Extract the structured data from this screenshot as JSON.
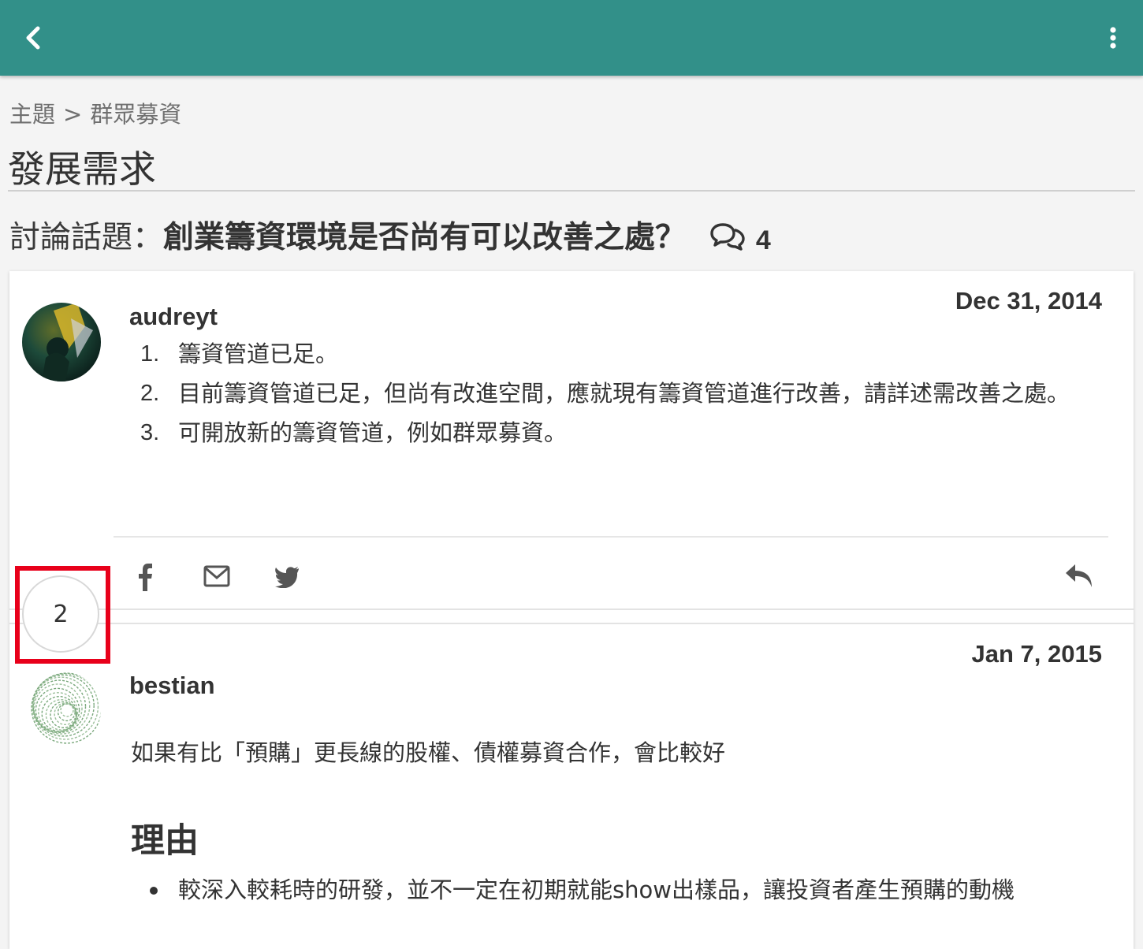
{
  "appbar": {
    "back_icon": "chevron-left-icon",
    "more_icon": "more-vertical-icon",
    "color": "#329089"
  },
  "breadcrumb": {
    "root": "主題",
    "separator": ">",
    "current": "群眾募資"
  },
  "page": {
    "title": "發展需求"
  },
  "topic": {
    "prefix": "討論話題：",
    "name": "創業籌資環境是否尚有可以改善之處？",
    "comment_count": "4"
  },
  "posts": [
    {
      "user": "audreyt",
      "date": "Dec 31, 2014",
      "items": [
        {
          "num": "1.",
          "text": "籌資管道已足。"
        },
        {
          "num": "2.",
          "text": "目前籌資管道已足，但尚有改進空間，應就現有籌資管道進行改善，請詳述需改善之處。"
        },
        {
          "num": "3.",
          "text": "可開放新的籌資管道，例如群眾募資。"
        }
      ],
      "actions": {
        "facebook_icon": "facebook-icon",
        "email_icon": "mail-icon",
        "twitter_icon": "twitter-icon",
        "reply_icon": "reply-icon"
      }
    },
    {
      "number": "2",
      "user": "bestian",
      "date": "Jan 7, 2015",
      "text": "如果有比「預購」更長線的股權、債權募資合作，會比較好",
      "heading": "理由",
      "bullets": [
        "較深入較耗時的研發，並不一定在初期就能show出樣品，讓投資者產生預購的動機"
      ]
    }
  ],
  "highlight_color": "#e8001a"
}
